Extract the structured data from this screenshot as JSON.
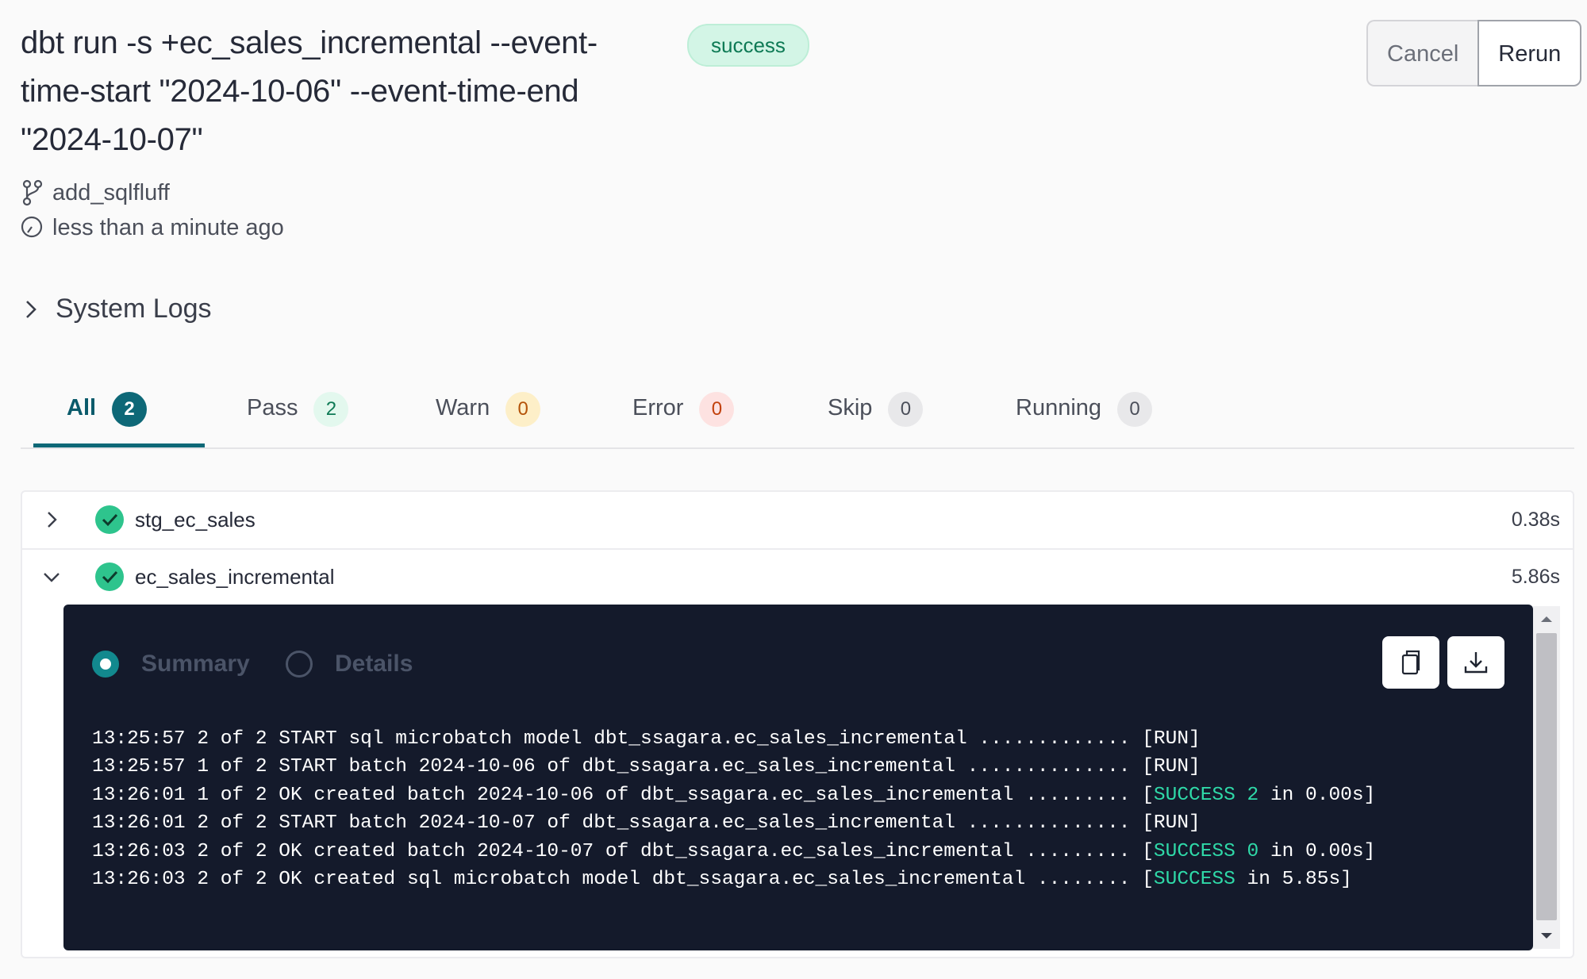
{
  "header": {
    "title_lines": [
      "dbt run -s +ec_sales_incremental --event-",
      "time-start \"2024-10-06\" --event-time-end",
      "\"2024-10-07\""
    ],
    "status": "success",
    "cancel_label": "Cancel",
    "rerun_label": "Rerun",
    "branch": "add_sqlfluff",
    "time": "less than a minute ago"
  },
  "system_logs_label": "System Logs",
  "tabs": [
    {
      "label": "All",
      "count": "2",
      "active": true,
      "bg": "#0e6877",
      "fg": "#ffffff"
    },
    {
      "label": "Pass",
      "count": "2",
      "bg": "#e3f8ee",
      "fg": "#0e7a55"
    },
    {
      "label": "Warn",
      "count": "0",
      "bg": "#fdefc8",
      "fg": "#b45309"
    },
    {
      "label": "Error",
      "count": "0",
      "bg": "#fde2e1",
      "fg": "#c2410c"
    },
    {
      "label": "Skip",
      "count": "0",
      "bg": "#e8e8ea",
      "fg": "#4b4f5a"
    },
    {
      "label": "Running",
      "count": "0",
      "bg": "#e8e8ea",
      "fg": "#4b4f5a"
    }
  ],
  "models": [
    {
      "name": "stg_ec_sales",
      "duration": "0.38s",
      "expanded": false
    },
    {
      "name": "ec_sales_incremental",
      "duration": "5.86s",
      "expanded": true
    }
  ],
  "log_panel": {
    "summary_label": "Summary",
    "details_label": "Details",
    "lines": [
      {
        "text": "13:25:57 2 of 2 START sql microbatch model dbt_ssagara.ec_sales_incremental ............. [RUN]"
      },
      {
        "text": "13:25:57 1 of 2 START batch 2024-10-06 of dbt_ssagara.ec_sales_incremental .............. [RUN]"
      },
      {
        "pre": "13:26:01 1 of 2 OK created batch 2024-10-06 of dbt_ssagara.ec_sales_incremental ......... [",
        "green": "SUCCESS 2",
        "post": " in 0.00s]"
      },
      {
        "text": "13:26:01 2 of 2 START batch 2024-10-07 of dbt_ssagara.ec_sales_incremental .............. [RUN]"
      },
      {
        "pre": "13:26:03 2 of 2 OK created batch 2024-10-07 of dbt_ssagara.ec_sales_incremental ......... [",
        "green": "SUCCESS 0",
        "post": " in 0.00s]"
      },
      {
        "pre": "13:26:03 2 of 2 OK created sql microbatch model dbt_ssagara.ec_sales_incremental ........ [",
        "green": "SUCCESS",
        "post": " in 5.85s]"
      }
    ]
  }
}
